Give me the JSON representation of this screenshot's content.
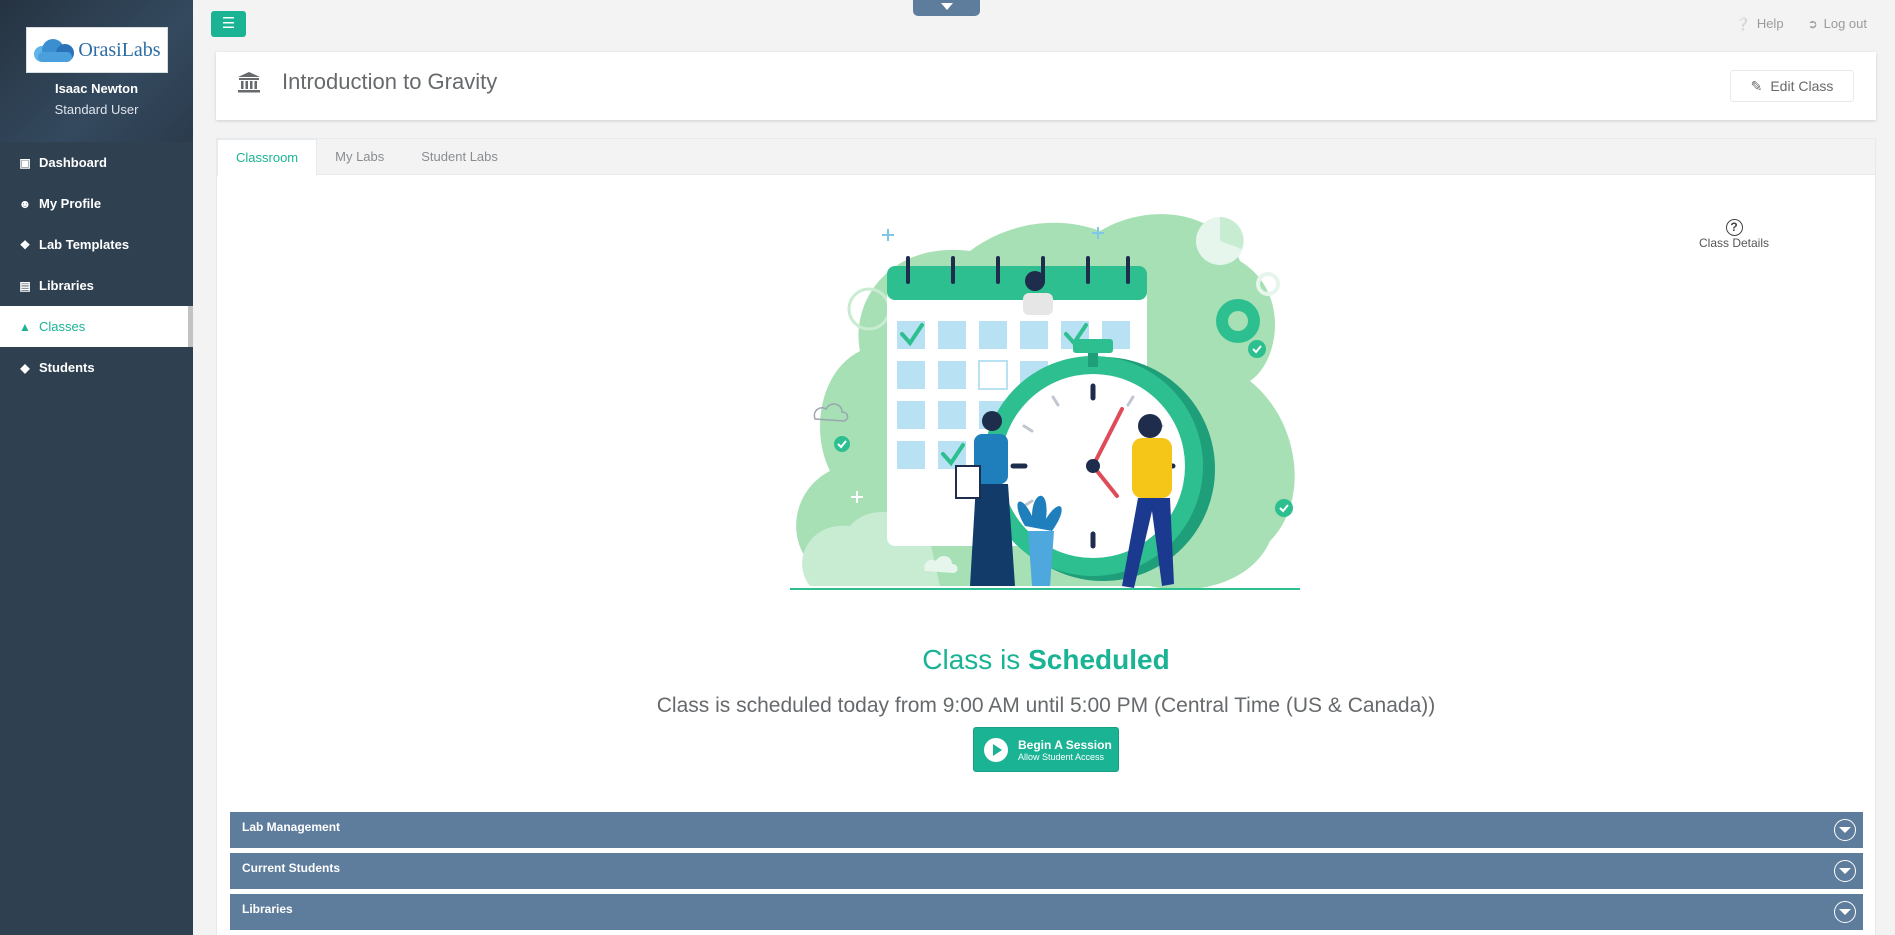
{
  "app": {
    "logo_text": "OrasiLabs"
  },
  "user": {
    "name": "Isaac Newton",
    "role": "Standard User"
  },
  "sidebar": {
    "items": [
      {
        "label": "Dashboard",
        "icon": "monitor-icon"
      },
      {
        "label": "My Profile",
        "icon": "user-icon"
      },
      {
        "label": "Lab Templates",
        "icon": "cubes-icon"
      },
      {
        "label": "Libraries",
        "icon": "book-icon"
      },
      {
        "label": "Classes",
        "icon": "institution-icon",
        "active": true
      },
      {
        "label": "Students",
        "icon": "graduation-cap-icon"
      }
    ]
  },
  "topbar": {
    "help": "Help",
    "logout": "Log out"
  },
  "header": {
    "title": "Introduction to Gravity",
    "edit_button": "Edit Class"
  },
  "tabs": [
    {
      "label": "Classroom",
      "active": true
    },
    {
      "label": "My Labs"
    },
    {
      "label": "Student Labs"
    }
  ],
  "class_details": {
    "label": "Class Details"
  },
  "status": {
    "prefix": "Class is",
    "state": "Scheduled",
    "schedule_text": "Class is scheduled today from 9:00 AM until 5:00 PM (Central Time (US & Canada))"
  },
  "begin_button": {
    "label": "Begin A Session",
    "sublabel": "Allow Student Access"
  },
  "accordions": [
    {
      "label": "Lab Management"
    },
    {
      "label": "Current Students"
    },
    {
      "label": "Libraries"
    }
  ],
  "colors": {
    "accent": "#1ab394",
    "sidebar": "#2f4050",
    "accordion": "#5e7d9c"
  }
}
